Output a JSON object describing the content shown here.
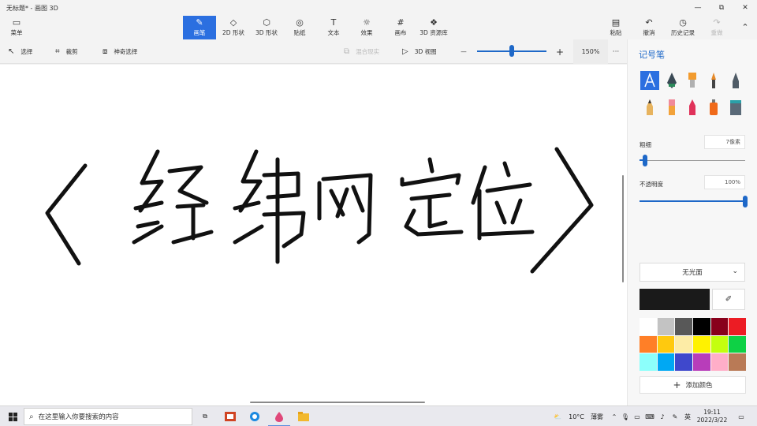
{
  "window": {
    "title": "无标题* - 画图 3D",
    "minimize_icon": "—",
    "restore_icon": "⧉",
    "close_icon": "✕"
  },
  "toolbar": {
    "menu": "菜单",
    "brushes": "画笔",
    "shapes_2d": "2D 形状",
    "shapes_3d": "3D 形状",
    "stickers": "贴纸",
    "text": "文本",
    "effects": "效果",
    "canvas": "画布",
    "library_3d": "3D 资源库",
    "paste": "粘贴",
    "undo": "撤消",
    "history": "历史记录",
    "redo": "重做"
  },
  "subbar": {
    "select": "选择",
    "crop": "裁剪",
    "magic_select": "神奇选择",
    "mixed_reality": "混合现实",
    "view_3d": "3D 视图",
    "zoom_out": "—",
    "zoom_in": "+",
    "zoom_level": 0.5,
    "zoom_percent": "150%",
    "more": "···"
  },
  "panel": {
    "title": "记号笔",
    "thickness_label": "粗细",
    "thickness_value": "7像素",
    "thickness_level": 0.05,
    "opacity_label": "不透明度",
    "opacity_value": "100%",
    "opacity_level": 1.0,
    "finish": "无光面",
    "add_color": "添加颜色",
    "current_color": "#1a1a1a",
    "palette": [
      "#ffffff",
      "#c3c3c3",
      "#585858",
      "#000000",
      "#88001b",
      "#ec1c24",
      "#ff7f27",
      "#ffc90e",
      "#fdeca6",
      "#fff200",
      "#c4ff0e",
      "#0ed145",
      "#8cfffb",
      "#00a8f3",
      "#3f48cc",
      "#b83dba",
      "#ffaec8",
      "#b97a56"
    ]
  },
  "taskbar": {
    "search_placeholder": "在这里输入你要搜索的内容",
    "weather_temp": "10°C",
    "weather_desc": "薄雾",
    "ime": "英",
    "time": "19:11",
    "date": "2022/3/22"
  }
}
